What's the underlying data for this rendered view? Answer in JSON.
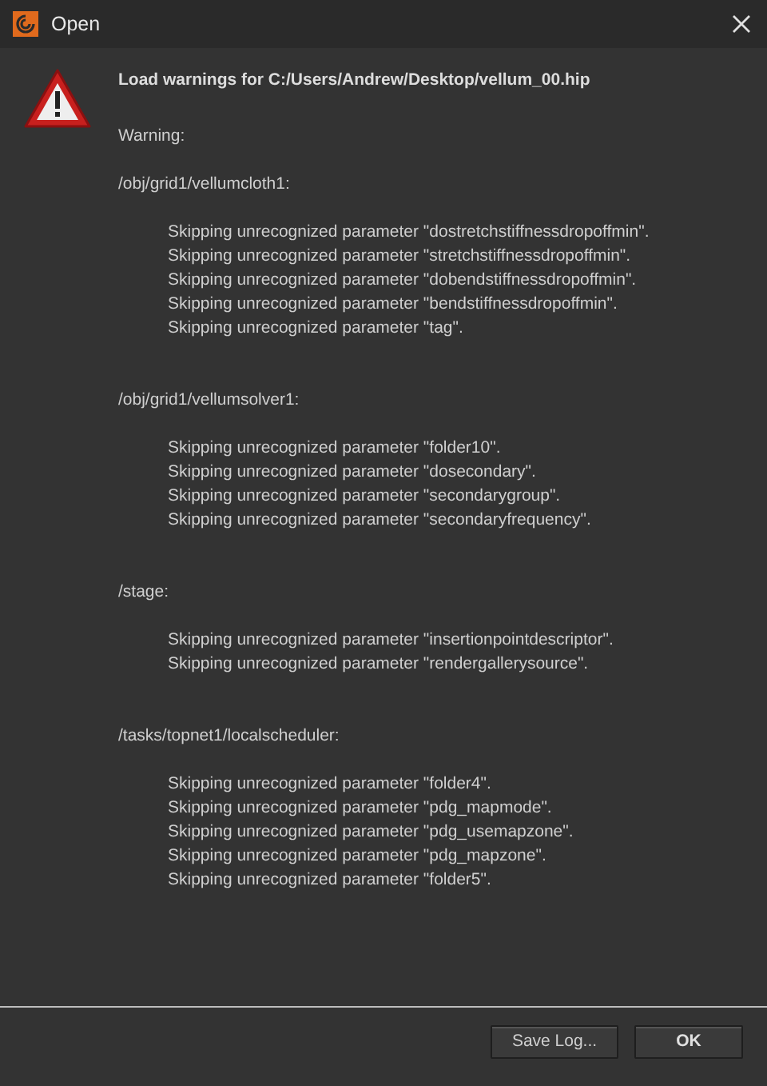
{
  "window": {
    "title": "Open"
  },
  "heading": "Load warnings for C:/Users/Andrew/Desktop/vellum_00.hip",
  "label": "Warning:",
  "sections": [
    {
      "path": "/obj/grid1/vellumcloth1:",
      "lines": [
        "Skipping unrecognized parameter \"dostretchstiffnessdropoffmin\".",
        "Skipping unrecognized parameter \"stretchstiffnessdropoffmin\".",
        "Skipping unrecognized parameter \"dobendstiffnessdropoffmin\".",
        "Skipping unrecognized parameter \"bendstiffnessdropoffmin\".",
        "Skipping unrecognized parameter \"tag\"."
      ]
    },
    {
      "path": "/obj/grid1/vellumsolver1:",
      "lines": [
        "Skipping unrecognized parameter \"folder10\".",
        "Skipping unrecognized parameter \"dosecondary\".",
        "Skipping unrecognized parameter \"secondarygroup\".",
        "Skipping unrecognized parameter \"secondaryfrequency\"."
      ]
    },
    {
      "path": "/stage:",
      "lines": [
        "Skipping unrecognized parameter \"insertionpointdescriptor\".",
        "Skipping unrecognized parameter \"rendergallerysource\"."
      ]
    },
    {
      "path": "/tasks/topnet1/localscheduler:",
      "lines": [
        "Skipping unrecognized parameter \"folder4\".",
        "Skipping unrecognized parameter \"pdg_mapmode\".",
        "Skipping unrecognized parameter \"pdg_usemapzone\".",
        "Skipping unrecognized parameter \"pdg_mapzone\".",
        "Skipping unrecognized parameter \"folder5\"."
      ]
    }
  ],
  "buttons": [
    {
      "label": "Save Log...",
      "kind": "normal"
    },
    {
      "label": "OK",
      "kind": "default"
    }
  ]
}
